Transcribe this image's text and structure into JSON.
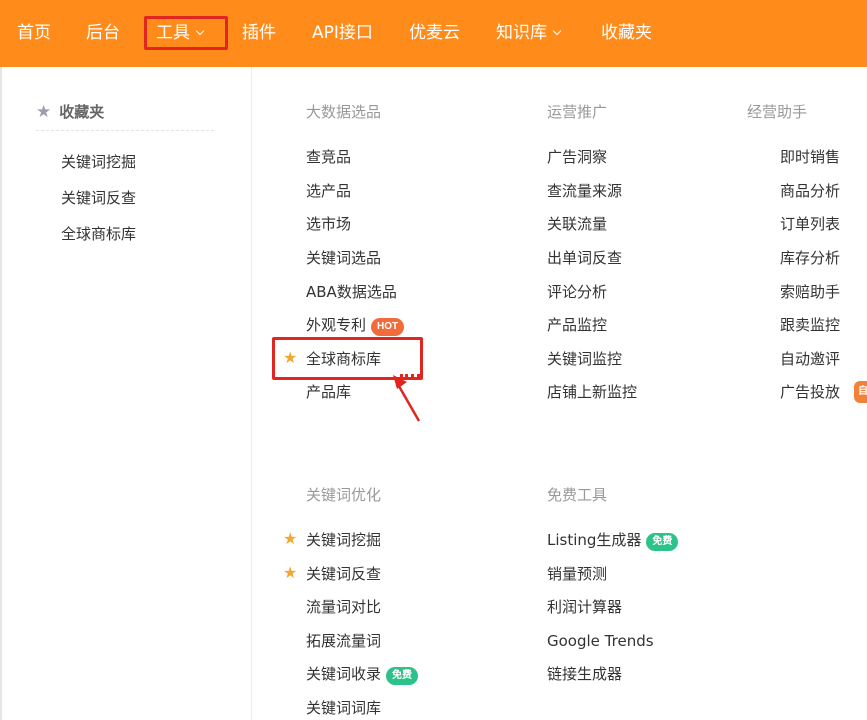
{
  "nav": {
    "items": [
      {
        "label": "首页"
      },
      {
        "label": "后台"
      },
      {
        "label": "工具",
        "active": true,
        "dropdown": true
      },
      {
        "label": "插件"
      },
      {
        "label": "API接口"
      },
      {
        "label": "优麦云"
      },
      {
        "label": "知识库",
        "dropdown": true
      },
      {
        "label": "收藏夹"
      }
    ],
    "bg_color": "#ff8c1a"
  },
  "favorites": {
    "title": "收藏夹",
    "icon": "star-icon",
    "items": [
      "关键词挖掘",
      "关键词反查",
      "全球商标库"
    ]
  },
  "sections": {
    "big_data": {
      "title": "大数据选品",
      "items": [
        "查竞品",
        "选产品",
        "选市场",
        "关键词选品",
        "ABA数据选品",
        "外观专利",
        "全球商标库",
        "产品库"
      ],
      "hot_badge": "HOT"
    },
    "operations": {
      "title": "运营推广",
      "items": [
        "广告洞察",
        "查流量来源",
        "关联流量",
        "出单词反查",
        "评论分析",
        "产品监控",
        "关键词监控",
        "店铺上新监控"
      ]
    },
    "assistant": {
      "title": "经营助手",
      "items": [
        "即时销售",
        "商品分析",
        "订单列表",
        "库存分析",
        "索赔助手",
        "跟卖监控",
        "自动邀评",
        "广告投放"
      ],
      "cut_badge": "自"
    },
    "keyword_opt": {
      "title": "关键词优化",
      "items": [
        "关键词挖掘",
        "关键词反查",
        "流量词对比",
        "拓展流量词",
        "关键词收录",
        "关键词词库"
      ],
      "free_badge": "免费"
    },
    "free_tools": {
      "title": "免费工具",
      "items": [
        "Listing生成器",
        "销量预测",
        "利润计算器",
        "Google Trends",
        "链接生成器"
      ],
      "free_badge": "免费"
    }
  },
  "colors": {
    "accent": "#ff8c1a",
    "highlight": "#e0261e",
    "star": "#f0a92e",
    "hot": "#f26b3a",
    "free": "#2cc38a"
  }
}
